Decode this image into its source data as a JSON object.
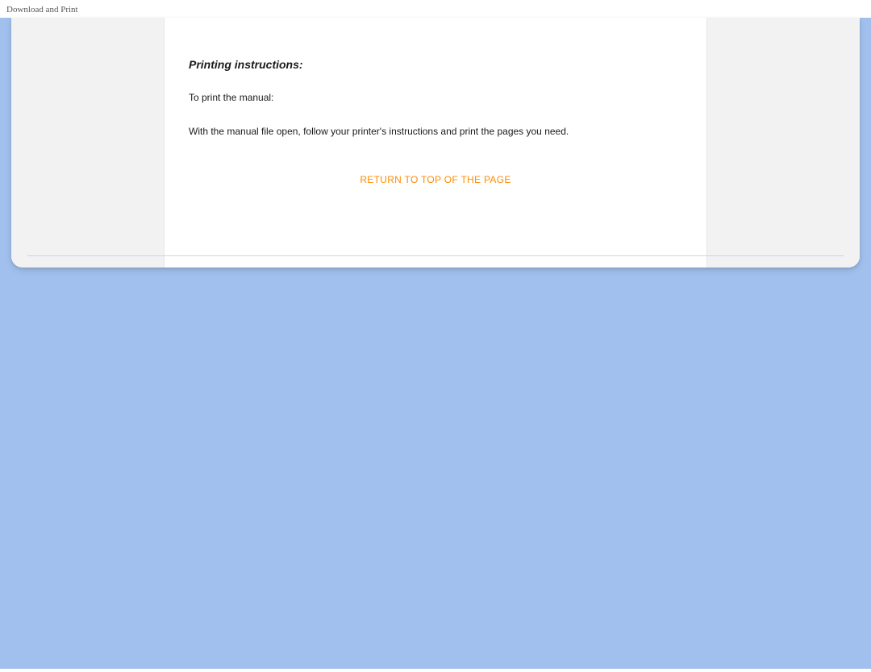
{
  "header": {
    "label": "Download and Print"
  },
  "main": {
    "heading": "Printing instructions:",
    "intro": "To print the manual:",
    "body": "With the manual file open, follow your printer's instructions and print the pages you need.",
    "return_link": "RETURN TO TOP OF THE PAGE"
  }
}
